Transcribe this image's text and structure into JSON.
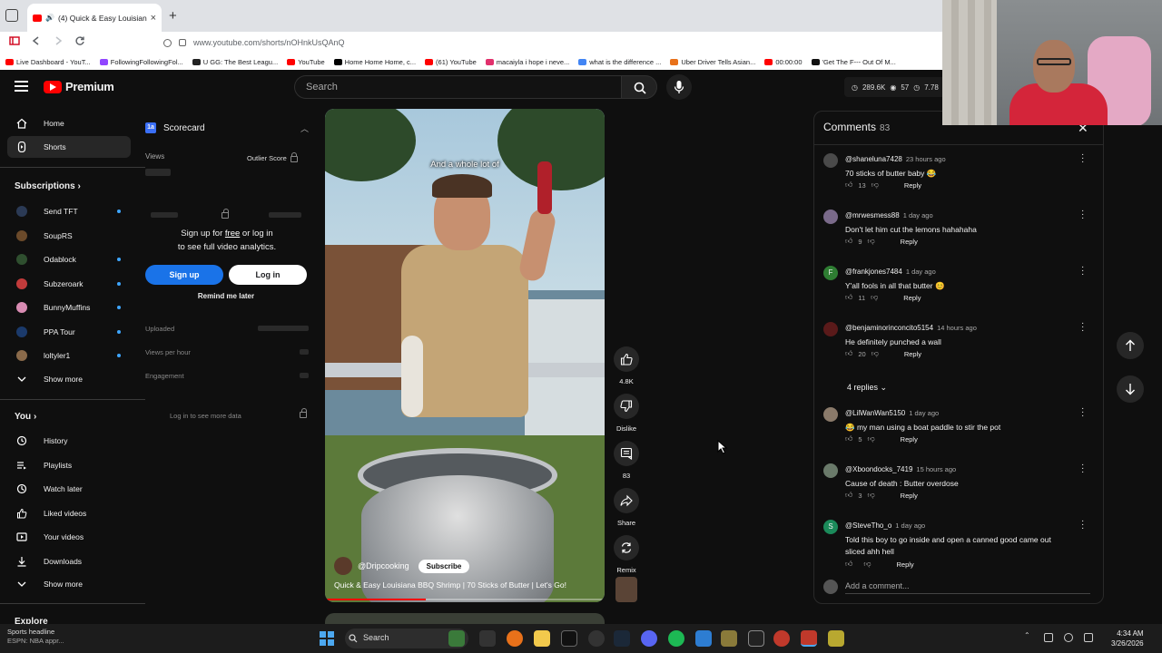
{
  "browser": {
    "tab_title": "(4) Quick & Easy Louisiana",
    "tab_close": "×",
    "new_tab": "+",
    "url": "www.youtube.com/shorts/nOHnkUsQAnQ",
    "bookmarks": [
      {
        "label": "Live Dashboard - YouT...",
        "color": "#ff0000"
      },
      {
        "label": "FollowingFollowingFol...",
        "color": "#9146ff"
      },
      {
        "label": "U GG: The Best Leagu...",
        "color": "#222222"
      },
      {
        "label": "YouTube",
        "color": "#ff0000"
      },
      {
        "label": "Home Home Home, c...",
        "color": "#000000"
      },
      {
        "label": "(61) YouTube",
        "color": "#ff0000"
      },
      {
        "label": "macaiyla i hope i neve...",
        "color": "#e1306c"
      },
      {
        "label": "what is the difference ...",
        "color": "#4285f4"
      },
      {
        "label": "Uber Driver Tells Asian...",
        "color": "#e8711a"
      },
      {
        "label": "00:00:00",
        "color": "#ff0000"
      },
      {
        "label": "'Get The F--- Out Of M...",
        "color": "#111111"
      }
    ]
  },
  "youtube": {
    "logo_text": "Premium",
    "search_placeholder": "Search",
    "stats": {
      "views": "289.6K",
      "likes": "57",
      "subs": "7.78"
    }
  },
  "sidebar": {
    "main": [
      {
        "label": "Home",
        "icon": "home-icon"
      },
      {
        "label": "Shorts",
        "icon": "shorts-icon",
        "active": true
      }
    ],
    "subscriptions_header": "Subscriptions",
    "subscriptions": [
      {
        "label": "Send TFT",
        "color": "#2b3a55",
        "dot": true
      },
      {
        "label": "SoupRS",
        "color": "#6b4a2a",
        "dot": false
      },
      {
        "label": "Odablock",
        "color": "#2f4f2f",
        "dot": true
      },
      {
        "label": "Subzeroark",
        "color": "#c23b3b",
        "dot": true
      },
      {
        "label": "BunnyMuffins",
        "color": "#d98cb3",
        "dot": true
      },
      {
        "label": "PPA Tour",
        "color": "#1b3a6b",
        "dot": true
      },
      {
        "label": "loltyler1",
        "color": "#8a6a4a",
        "dot": true
      }
    ],
    "show_more_1": "Show more",
    "you_header": "You",
    "you_items": [
      {
        "label": "History",
        "icon": "history-icon"
      },
      {
        "label": "Playlists",
        "icon": "playlists-icon"
      },
      {
        "label": "Watch later",
        "icon": "watch-later-icon"
      },
      {
        "label": "Liked videos",
        "icon": "liked-videos-icon"
      },
      {
        "label": "Your videos",
        "icon": "your-videos-icon"
      },
      {
        "label": "Downloads",
        "icon": "downloads-icon"
      }
    ],
    "show_more_2": "Show more",
    "explore_header": "Explore"
  },
  "scorecard": {
    "badge": "1a",
    "title": "Scorecard",
    "views_label": "Views",
    "outlier_label": "Outlier Score",
    "signup_prefix": "Sign up for ",
    "signup_free": "free",
    "signup_suffix": " or log in",
    "signup_line2": "to see full video analytics.",
    "signup_button": "Sign up",
    "login_button": "Log in",
    "remind_label": "Remind me later",
    "uploaded_label": "Uploaded",
    "views_per_hour_label": "Views per hour",
    "engagement_label": "Engagement",
    "more_data_label": "Log in to see more data"
  },
  "video": {
    "caption": "And a whole lot of",
    "channel": "@Dripcooking",
    "subscribe_label": "Subscribe",
    "title": "Quick & Easy Louisiana BBQ Shrimp | 70 Sticks of Butter | Let's Go!",
    "progress": 0.36
  },
  "actions": {
    "like_count": "4.8K",
    "dislike_label": "Dislike",
    "comment_count": "83",
    "share_label": "Share",
    "remix_label": "Remix"
  },
  "comments": {
    "title": "Comments",
    "count": "83",
    "close": "✕",
    "reply_label": "Reply",
    "items": [
      {
        "author": "@shaneluna7428",
        "time": "23 hours ago",
        "text": "70 sticks of butter baby 😂",
        "likes": "13",
        "avatar": "#4a4a4a"
      },
      {
        "author": "@mrwesmess88",
        "time": "1 day ago",
        "text": "Don't let him cut the lemons hahahaha",
        "likes": "9",
        "avatar": "#7a6a8a"
      },
      {
        "author": "@frankjones7484",
        "time": "1 day ago",
        "text": "Y'all fools in all that butter 😊",
        "likes": "11",
        "avatar": "#2e7d32",
        "initial": "F"
      },
      {
        "author": "@benjaminorinconcito5154",
        "time": "14 hours ago",
        "text": "He definitely punched a wall",
        "likes": "20",
        "avatar": "#5a1a1a"
      },
      {
        "author": "@LilWanWan5150",
        "time": "1 day ago",
        "text": "😂 my man using a boat paddle to stir the pot",
        "likes": "5",
        "avatar": "#8a7a6a"
      },
      {
        "author": "@Xboondocks_7419",
        "time": "15 hours ago",
        "text": "Cause of death : Butter overdose",
        "likes": "3",
        "avatar": "#6a7a6a"
      },
      {
        "author": "@SteveTho_o",
        "time": "1 day ago",
        "text": "Told this boy to go inside and open a canned good came out sliced ahh hell",
        "likes": "",
        "avatar": "#1b8a5a",
        "initial": "S"
      }
    ],
    "replies_label": "4 replies",
    "add_placeholder": "Add a comment..."
  },
  "taskbar": {
    "news_title": "Sports headline",
    "news_sub": "ESPN: NBA appr...",
    "search_label": "Search",
    "time": "4:34 AM",
    "date": "3/26/2026"
  }
}
